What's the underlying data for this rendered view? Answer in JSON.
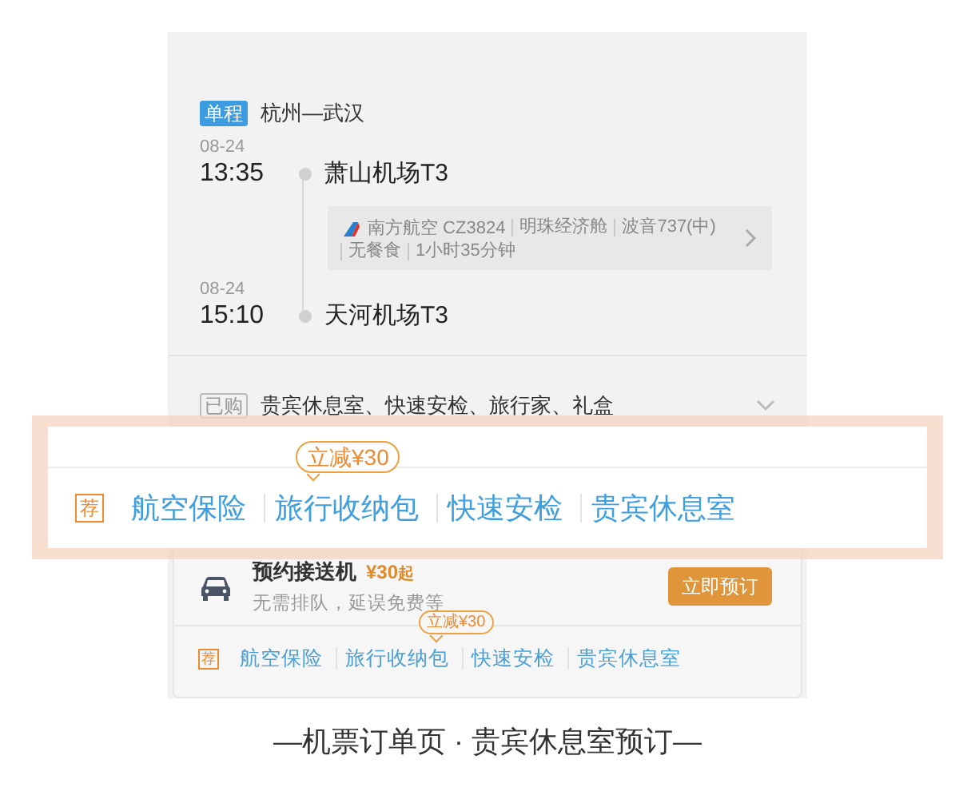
{
  "trip": {
    "badge": "单程",
    "route": "杭州—武汉"
  },
  "departure": {
    "date": "08-24",
    "time": "13:35",
    "airport": "萧山机场T3"
  },
  "flight_info": {
    "lines": [
      [
        "南方航空 CZ3824",
        "明珠经济舱",
        "波音737(中)"
      ],
      [
        "无餐食",
        "1小时35分钟"
      ]
    ]
  },
  "arrival": {
    "date": "08-24",
    "time": "15:10",
    "airport": "天河机场T3"
  },
  "purchased": {
    "badge": "已购",
    "items": "贵宾休息室、快速安检、旅行家、礼盒"
  },
  "transfer": {
    "title": "预约接送机",
    "price": "¥30",
    "price_suffix": "起",
    "subtitle": "无需排队，延误免费等",
    "button": "立即预订"
  },
  "recommend": {
    "tag": "荐",
    "items": [
      {
        "label": "航空保险"
      },
      {
        "label": "旅行收纳包",
        "promo": "立减¥30"
      },
      {
        "label": "快速安检"
      },
      {
        "label": "贵宾休息室"
      }
    ]
  },
  "magnified": {
    "tag": "荐",
    "items": [
      {
        "label": "航空保险"
      },
      {
        "label": "旅行收纳包",
        "promo": "立减¥30"
      },
      {
        "label": "快速安检"
      },
      {
        "label": "贵宾休息室"
      }
    ]
  },
  "caption": "—机票订单页 · 贵宾休息室预订—"
}
